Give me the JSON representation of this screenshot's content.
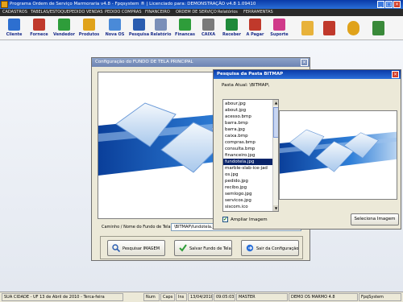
{
  "app": {
    "title": "Programa Ordem de Serviço Marmoraria v4.8 - Fpqsystem ® | Licenciado para: DEMONSTRAÇÃO v4.8 1.09410",
    "minimize": "_",
    "maximize": "□",
    "close": "×"
  },
  "menu": [
    {
      "label": "CADASTROS"
    },
    {
      "label": "TABELAS/ESTOQUE"
    },
    {
      "label": "PEDIDO VENDAS"
    },
    {
      "label": "PEDIDO COMPRAS"
    },
    {
      "label": "FINANCEIRO"
    },
    {
      "label": "ORDEM DE SERVIÇO"
    },
    {
      "label": "Relatórios"
    },
    {
      "label": "FERRAMENTAS"
    }
  ],
  "toolbar": [
    {
      "label": "Cliente",
      "icon": "clients-icon",
      "color": "#2d6fd0"
    },
    {
      "label": "Fornece",
      "icon": "supplier-icon",
      "color": "#c0392b"
    },
    {
      "label": "Vendedor",
      "icon": "seller-icon",
      "color": "#2e9d3a"
    },
    {
      "label": "Produtos",
      "icon": "products-icon",
      "color": "#e0a21a"
    },
    {
      "label": "Nova OS",
      "icon": "new-os-icon",
      "color": "#4a8ad8"
    },
    {
      "label": "Pesquisa",
      "icon": "search-icon",
      "color": "#2a5db0"
    },
    {
      "label": "Relatório",
      "icon": "report-icon",
      "color": "#7a8fb8"
    },
    {
      "label": "Financas",
      "icon": "finance-icon",
      "color": "#2e9d3a"
    },
    {
      "label": "CAIXA",
      "icon": "cash-icon",
      "color": "#7a7a7a"
    },
    {
      "label": "Receber",
      "icon": "receive-icon",
      "color": "#1f8a3a"
    },
    {
      "label": "A Pagar",
      "icon": "pay-icon",
      "color": "#c0392b"
    },
    {
      "label": "Suporte",
      "icon": "support-icon",
      "color": "#d03a8a"
    },
    {
      "label": "",
      "icon": "calculator-icon",
      "color": "#e8b23a"
    },
    {
      "label": "",
      "icon": "tools-icon",
      "color": "#c0392b"
    },
    {
      "label": "",
      "icon": "settings-icon",
      "color": "#e0a21a"
    },
    {
      "label": "",
      "icon": "exit-icon",
      "color": "#3a8a3a"
    }
  ],
  "config_window": {
    "title": "Configuração do FUNDO DE TELA PRINCIPAL",
    "path_label": "Caminho / Nome do Fundo de Tela",
    "path_value": "\\BITMAP\\fundotela.jpg",
    "buttons": [
      {
        "label": "Pesquisar IMAGEM",
        "icon": "search-icon"
      },
      {
        "label": "Salvar Fundo de Tela",
        "icon": "check-icon"
      },
      {
        "label": "Sair da Configuração",
        "icon": "exit-icon"
      }
    ]
  },
  "search_dialog": {
    "title": "Pesquisa da Pasta BITMAP",
    "folder_label": "Pasta Atual: \\BITMAP\\",
    "files": [
      "abour.jpg",
      "about.jpg",
      "acesso.bmp",
      "barra.bmp",
      "barra.jpg",
      "caixa.bmp",
      "compras.bmp",
      "consulta.bmp",
      "financeiro.jpg",
      "fundotela.jpg",
      "marble-slab-ice-jad",
      "os.jpg",
      "pedido.jpg",
      "recibo.jpg",
      "semlogo.jpg",
      "servicos.jpg",
      "siscom.ico",
      "vendas.gif"
    ],
    "selected_file": "fundotela.jpg",
    "checkbox_checked": true,
    "checkbox_mark": "✔",
    "checkbox_label": "Ampliar Imagem",
    "select_button": "Seleciona Imagem",
    "close": "×"
  },
  "status": {
    "city": "SUA CIDADE - UF 13 de Abril de 2010 - Terca-feira",
    "num": "Num",
    "caps": "Caps",
    "ins": "Ins",
    "date": "13/04/2010",
    "time": "09:05:03",
    "master": "MASTER",
    "demo": "DEMO OS MARMO 4.8",
    "brand": "FpqSystem"
  }
}
